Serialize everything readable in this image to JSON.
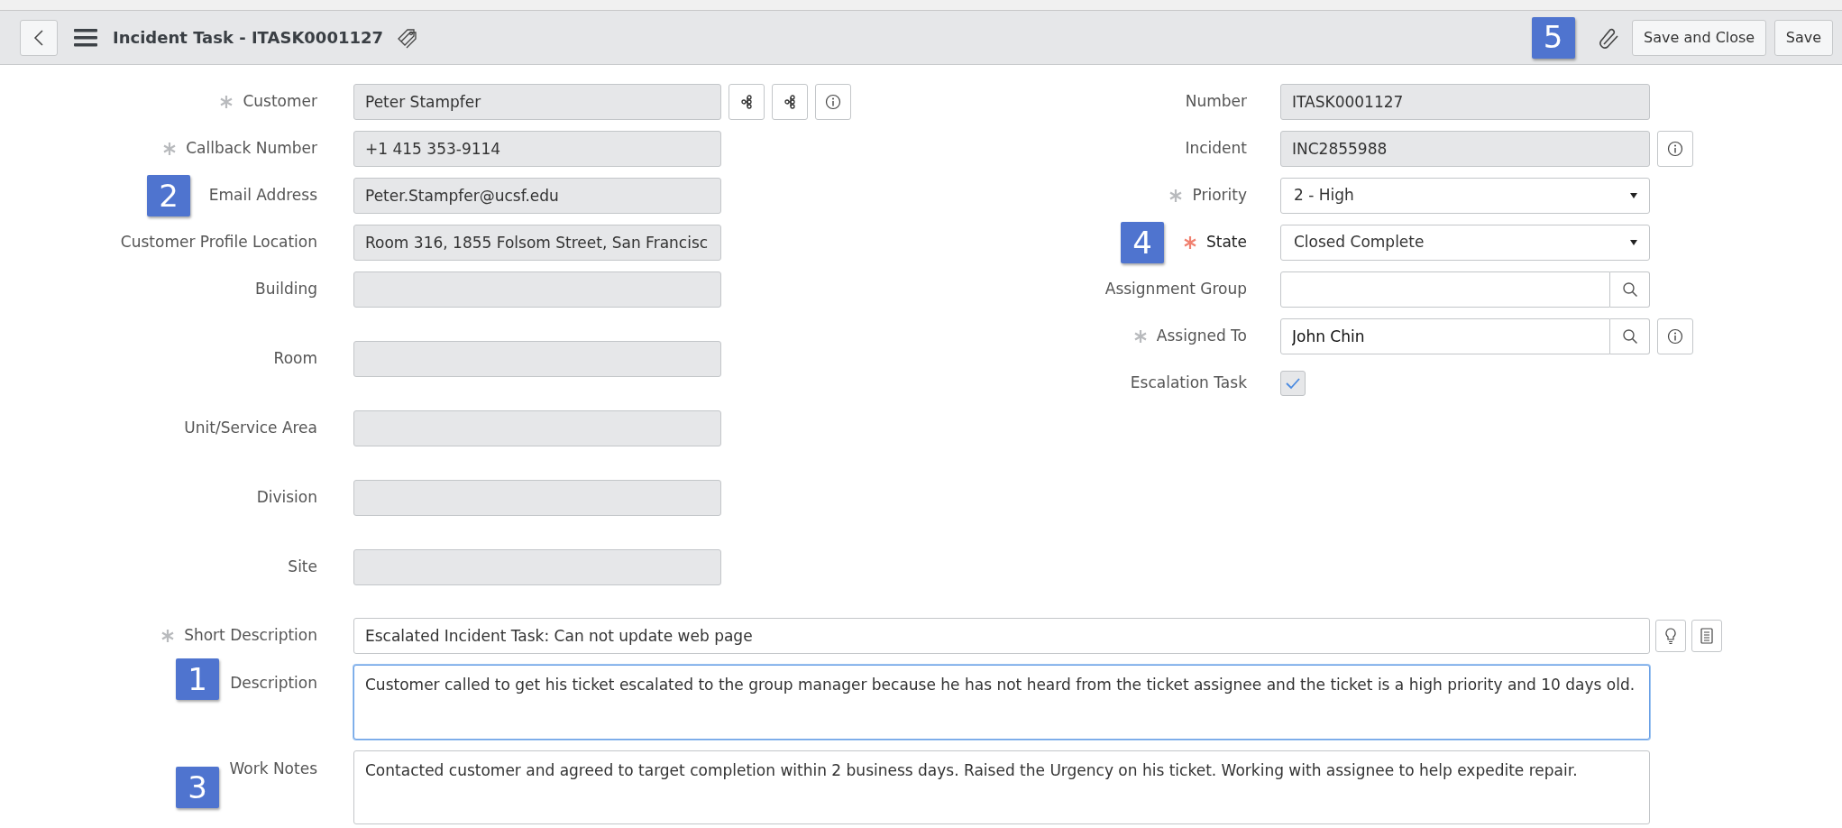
{
  "header": {
    "title": "Incident Task - ITASK0001127",
    "annotation": "5",
    "buttons": [
      "Save and Close",
      "Save"
    ]
  },
  "left_fields": [
    {
      "label": "Customer",
      "required": true,
      "modified": false,
      "kind": "text",
      "readonly": true,
      "value": "Peter Stampfer",
      "actions": [
        {
          "kind": "hierarchy"
        },
        {
          "kind": "hierarchy"
        },
        {
          "kind": "info"
        }
      ]
    },
    {
      "label": "Callback Number",
      "required": true,
      "modified": false,
      "kind": "text",
      "readonly": true,
      "value": "+1 415 353-9114"
    },
    {
      "label": "Email Address",
      "required": false,
      "kind": "text",
      "readonly": true,
      "value": "Peter.Stampfer@ucsf.edu",
      "annotation": "2"
    },
    {
      "label": "Customer Profile Location",
      "required": false,
      "kind": "text",
      "readonly": true,
      "value": "Room 316, 1855 Folsom Street, San Francisc"
    },
    {
      "label": "Building",
      "required": false,
      "kind": "text",
      "readonly": true
    },
    {
      "label": "Room",
      "required": false,
      "kind": "text",
      "readonly": true
    },
    {
      "label": "Unit/Service Area",
      "required": false,
      "kind": "text",
      "readonly": true
    },
    {
      "label": "Division",
      "required": false,
      "kind": "text",
      "readonly": true
    },
    {
      "label": "Site",
      "required": false,
      "kind": "text",
      "readonly": true
    }
  ],
  "right_fields": [
    {
      "label": "Number",
      "required": false,
      "kind": "text",
      "readonly": true,
      "value": "ITASK0001127"
    },
    {
      "label": "Incident",
      "required": false,
      "kind": "text",
      "readonly": true,
      "value": "INC2855988",
      "actions": [
        {
          "kind": "info"
        }
      ]
    },
    {
      "label": "Priority",
      "required": true,
      "modified": false,
      "kind": "select",
      "value": "2 - High"
    },
    {
      "label": "State",
      "required": true,
      "modified": true,
      "kind": "select",
      "value": "Closed Complete",
      "annotation": "4"
    },
    {
      "label": "Assignment Group",
      "required": false,
      "kind": "reference"
    },
    {
      "label": "Assigned To",
      "required": true,
      "modified": false,
      "kind": "reference",
      "value": "John Chin",
      "actions": [
        {
          "kind": "info"
        }
      ]
    },
    {
      "label": "Escalation Task",
      "required": false,
      "kind": "checkbox",
      "checked": true
    }
  ],
  "wide_fields": [
    {
      "label": "Short Description",
      "required": true,
      "modified": false,
      "kind": "text",
      "readonly": false,
      "value": "Escalated Incident Task: Can not update web page",
      "actions": [
        {
          "kind": "suggestion"
        },
        {
          "kind": "template"
        }
      ]
    },
    {
      "label": "Description",
      "required": false,
      "kind": "textarea",
      "focused": true,
      "value": "Customer called to get his ticket escalated to the group manager because he has not heard from the ticket assignee and the ticket is a high priority and 10 days old.",
      "annotation": "1"
    },
    {
      "label": "Work Notes",
      "required": false,
      "kind": "textarea",
      "focused": false,
      "value": "Contacted customer and agreed to target completion within 2 business days. Raised the Urgency on his ticket. Working with assignee to help expedite repair.",
      "annotation": "3"
    }
  ]
}
